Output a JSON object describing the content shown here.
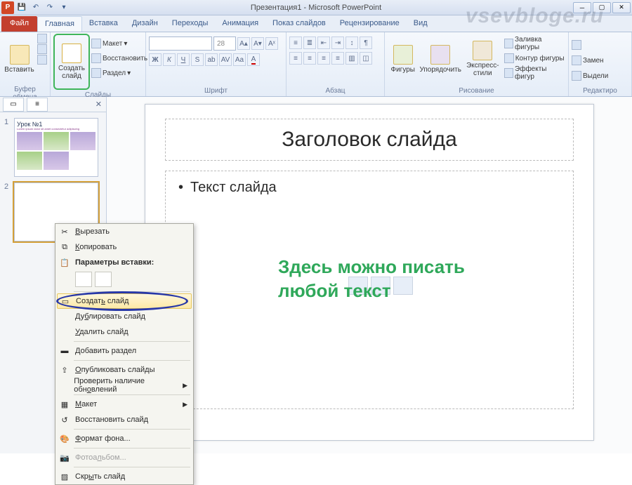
{
  "titlebar": {
    "title": "Презентация1 - Microsoft PowerPoint"
  },
  "watermark": "vsevbloge.ru",
  "tabs": {
    "file": "Файл",
    "items": [
      "Главная",
      "Вставка",
      "Дизайн",
      "Переходы",
      "Анимация",
      "Показ слайдов",
      "Рецензирование",
      "Вид"
    ]
  },
  "ribbon": {
    "clipboard": {
      "label": "Буфер обмена",
      "paste": "Вставить"
    },
    "slides": {
      "label": "Слайды",
      "new": "Создать слайд",
      "layout": "Макет",
      "reset": "Восстановить",
      "section": "Раздел"
    },
    "font": {
      "label": "Шрифт",
      "size": "28"
    },
    "paragraph": {
      "label": "Абзац"
    },
    "drawing": {
      "label": "Рисование",
      "shapes": "Фигуры",
      "arrange": "Упорядочить",
      "quick": "Экспресс-стили",
      "fill": "Заливка фигуры",
      "outline": "Контур фигуры",
      "effects": "Эффекты фигур"
    },
    "editing": {
      "label": "Редактиро",
      "replace": "Замен",
      "select": "Выдели"
    }
  },
  "thumbs": {
    "s1": {
      "num": "1",
      "title": "Урок №1"
    },
    "s2": {
      "num": "2"
    }
  },
  "slide": {
    "title": "Заголовок слайда",
    "bullet": "Текст слайда",
    "annotation_l1": "Здесь можно писать",
    "annotation_l2": "любой текст"
  },
  "context": {
    "cut": "Вырезать",
    "copy": "Копировать",
    "paste_opts": "Параметры вставки:",
    "new_slide": "Создать слайд",
    "duplicate": "Дублировать слайд",
    "delete": "Удалить слайд",
    "add_section": "Добавить раздел",
    "publish": "Опубликовать слайды",
    "check_upd": "Проверить наличие обновлений",
    "layout": "Макет",
    "reset": "Восстановить слайд",
    "format_bg": "Формат фона...",
    "photo_album": "Фотоальбом...",
    "hide": "Скрыть слайд"
  }
}
